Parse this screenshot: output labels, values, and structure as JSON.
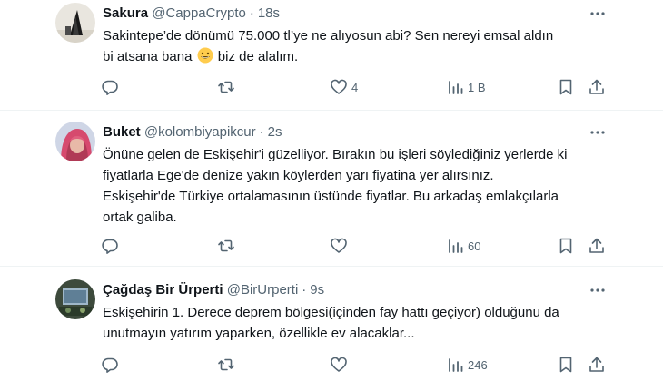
{
  "tweets": [
    {
      "name": "Sakura",
      "handle": "@CappaCrypto",
      "dot": "·",
      "time": "18s",
      "lines": [
        "Sakintepe’de dönümü 75.000 tl’ye ne alıyosun abi? Sen nereyi emsal aldın",
        "bi atsana bana",
        "biz de alalım."
      ],
      "emoji": "grinning-face-emoji",
      "likes": "4",
      "views": "1 B"
    },
    {
      "name": "Buket",
      "handle": "@kolombiyapikcur",
      "dot": "·",
      "time": "2s",
      "lines": [
        "Önüne gelen de Eskişehir'i güzelliyor. Bırakın bu işleri söylediğiniz yerlerde ki",
        "fiyatlarla Ege'de denize yakın köylerden yarı fiyatina yer alırsınız.",
        "Eskişehir'de Türkiye ortalamasının üstünde fiyatlar. Bu arkadaş emlakçılarla",
        "ortak galiba."
      ],
      "views": "60"
    },
    {
      "name": "Çağdaş Bir Ürperti",
      "handle": "@BirUrperti",
      "dot": "·",
      "time": "9s",
      "lines": [
        "Eskişehirin 1. Derece deprem bölgesi(içinden fay hattı geçiyor) olduğunu da",
        "unutmayın yatırım yaparken, özellikle ev alacaklar..."
      ],
      "views": "246"
    }
  ],
  "icons": {
    "more": "more-horizontal-icon",
    "reply": "reply-icon",
    "retweet": "retweet-icon",
    "like": "heart-icon",
    "views": "views-chart-icon",
    "bookmark": "bookmark-icon",
    "share": "share-icon"
  },
  "colors": {
    "text": "#0f1419",
    "secondary": "#536471",
    "divider": "#eff3f4"
  }
}
